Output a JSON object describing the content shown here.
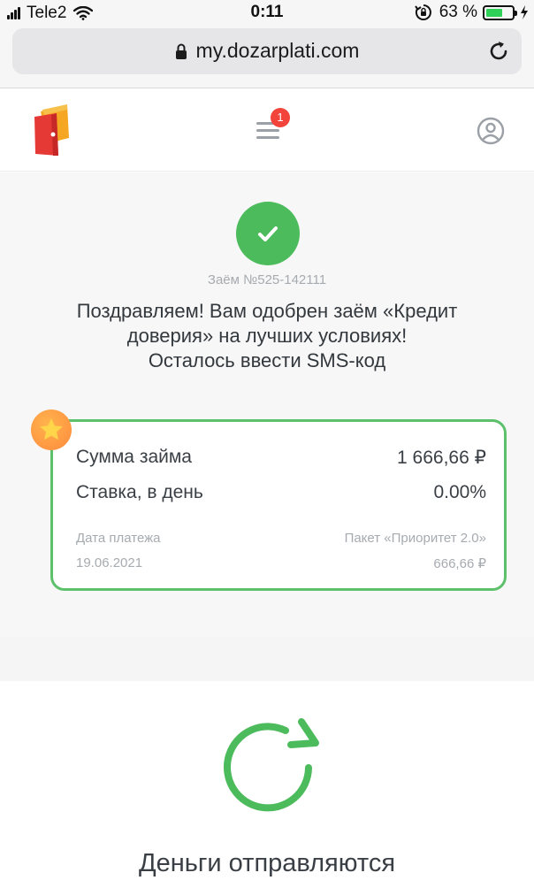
{
  "status_bar": {
    "carrier": "Tele2",
    "time": "0:11",
    "battery_percent": "63 %",
    "battery_level": 0.63
  },
  "browser": {
    "url": "my.dozarplati.com",
    "icons": [
      "lock-icon",
      "reload-icon"
    ]
  },
  "header": {
    "menu_badge_count": "1",
    "icons": [
      "wallet-logo-icon",
      "hamburger-menu-icon",
      "profile-icon"
    ]
  },
  "approval": {
    "loan_number": "Заём №525-142111",
    "headline_lines": [
      "Поздравляем! Вам одобрен заём «Кредит",
      "доверия» на лучших условиях!",
      "Осталось ввести SMS-код"
    ]
  },
  "card": {
    "amount_label": "Сумма займа",
    "amount_value": "1 666,66 ₽",
    "rate_label": "Ставка, в день",
    "rate_value": "0.00%",
    "payment_date_label": "Дата платежа",
    "payment_date_value": "19.06.2021",
    "package_label": "Пакет «Приоритет 2.0»",
    "package_value": "666,66 ₽"
  },
  "sending": {
    "label": "Деньги отправляются"
  },
  "colors": {
    "accent_green": "#4cbb5b",
    "badge_red": "#f2443a",
    "star_orange": "#ff9a3d",
    "logo_red": "#e53935",
    "logo_orange": "#f5a623"
  }
}
